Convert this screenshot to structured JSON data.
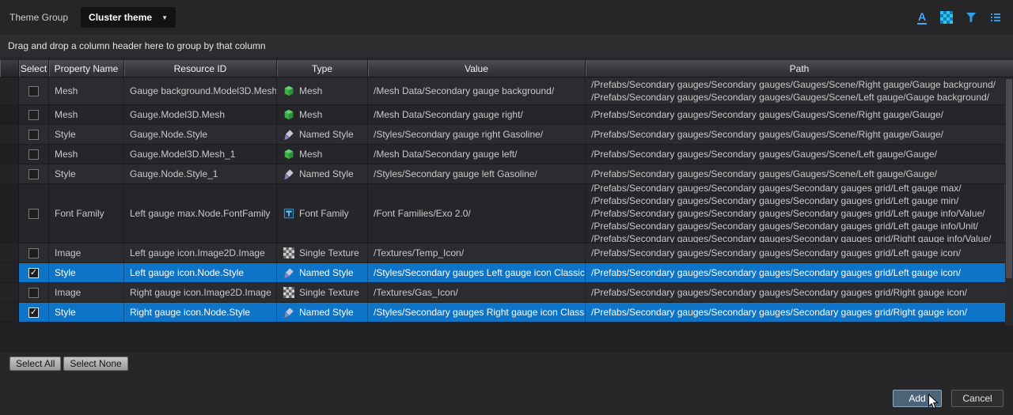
{
  "header": {
    "title": "Theme Group",
    "theme_selector": "Cluster theme",
    "toolbar_icons": [
      {
        "name": "font-color-icon",
        "glyph": "A"
      },
      {
        "name": "texture-atlas-icon"
      },
      {
        "name": "filter-icon"
      },
      {
        "name": "list-view-icon"
      }
    ]
  },
  "group_bar": {
    "hint": "Drag and drop a column header here to group by that column"
  },
  "colors": {
    "accent": "#3fa9f5",
    "selection": "#0e74c8"
  },
  "table": {
    "columns": [
      "Select",
      "Property Name",
      "Resource ID",
      "Type",
      "Value",
      "Path"
    ],
    "rows": [
      {
        "checked": false,
        "selected": false,
        "property": "Mesh",
        "resource_id": "Gauge background.Model3D.Mesh",
        "type": "Mesh",
        "type_icon": "mesh",
        "value": "/Mesh Data/Secondary gauge background/",
        "paths": [
          "/Prefabs/Secondary gauges/Secondary gauges/Gauges/Scene/Right gauge/Gauge background/",
          "/Prefabs/Secondary gauges/Secondary gauges/Gauges/Scene/Left gauge/Gauge background/"
        ],
        "path_scroll": false
      },
      {
        "checked": false,
        "selected": false,
        "property": "Mesh",
        "resource_id": "Gauge.Model3D.Mesh",
        "type": "Mesh",
        "type_icon": "mesh",
        "value": "/Mesh Data/Secondary gauge right/",
        "paths": [
          "/Prefabs/Secondary gauges/Secondary gauges/Gauges/Scene/Right gauge/Gauge/"
        ],
        "path_scroll": false
      },
      {
        "checked": false,
        "selected": false,
        "property": "Style",
        "resource_id": "Gauge.Node.Style",
        "type": "Named Style",
        "type_icon": "named-style",
        "value": "/Styles/Secondary gauge right Gasoline/",
        "paths": [
          "/Prefabs/Secondary gauges/Secondary gauges/Gauges/Scene/Right gauge/Gauge/"
        ],
        "path_scroll": false
      },
      {
        "checked": false,
        "selected": false,
        "property": "Mesh",
        "resource_id": "Gauge.Model3D.Mesh_1",
        "type": "Mesh",
        "type_icon": "mesh",
        "value": "/Mesh Data/Secondary gauge left/",
        "paths": [
          "/Prefabs/Secondary gauges/Secondary gauges/Gauges/Scene/Left gauge/Gauge/"
        ],
        "path_scroll": false
      },
      {
        "checked": false,
        "selected": false,
        "property": "Style",
        "resource_id": "Gauge.Node.Style_1",
        "type": "Named Style",
        "type_icon": "named-style",
        "value": "/Styles/Secondary gauge left Gasoline/",
        "paths": [
          "/Prefabs/Secondary gauges/Secondary gauges/Gauges/Scene/Left gauge/Gauge/"
        ],
        "path_scroll": false
      },
      {
        "checked": false,
        "selected": false,
        "property": "Font Family",
        "resource_id": "Left gauge max.Node.FontFamily",
        "type": "Font Family",
        "type_icon": "font-family",
        "value": "/Font Families/Exo 2.0/",
        "paths": [
          "/Prefabs/Secondary gauges/Secondary gauges/Secondary gauges grid/Left gauge max/",
          "/Prefabs/Secondary gauges/Secondary gauges/Secondary gauges grid/Left gauge min/",
          "/Prefabs/Secondary gauges/Secondary gauges/Secondary gauges grid/Left gauge info/Value/",
          "/Prefabs/Secondary gauges/Secondary gauges/Secondary gauges grid/Left gauge info/Unit/",
          "/Prefabs/Secondary gauges/Secondary gauges/Secondary gauges grid/Right gauge info/Value/"
        ],
        "path_scroll": true
      },
      {
        "checked": false,
        "selected": false,
        "property": "Image",
        "resource_id": "Left gauge icon.Image2D.Image",
        "type": "Single Texture",
        "type_icon": "single-texture",
        "value": "/Textures/Temp_Icon/",
        "paths": [
          "/Prefabs/Secondary gauges/Secondary gauges/Secondary gauges grid/Left gauge icon/"
        ],
        "path_scroll": false
      },
      {
        "checked": true,
        "selected": true,
        "property": "Style",
        "resource_id": "Left gauge icon.Node.Style",
        "type": "Named Style",
        "type_icon": "named-style",
        "value": "/Styles/Secondary gauges Left gauge icon Classic/",
        "paths": [
          "/Prefabs/Secondary gauges/Secondary gauges/Secondary gauges grid/Left gauge icon/"
        ],
        "path_scroll": false
      },
      {
        "checked": false,
        "selected": false,
        "property": "Image",
        "resource_id": "Right gauge icon.Image2D.Image",
        "type": "Single Texture",
        "type_icon": "single-texture",
        "value": "/Textures/Gas_Icon/",
        "paths": [
          "/Prefabs/Secondary gauges/Secondary gauges/Secondary gauges grid/Right gauge icon/"
        ],
        "path_scroll": false
      },
      {
        "checked": true,
        "selected": true,
        "property": "Style",
        "resource_id": "Right gauge icon.Node.Style",
        "type": "Named Style",
        "type_icon": "named-style",
        "value": "/Styles/Secondary gauges Right gauge icon Classic/",
        "paths": [
          "/Prefabs/Secondary gauges/Secondary gauges/Secondary gauges grid/Right gauge icon/"
        ],
        "path_scroll": false
      }
    ]
  },
  "footer": {
    "select_all_label": "Select All",
    "select_none_label": "Select None",
    "add_label": "Add",
    "cancel_label": "Cancel"
  }
}
